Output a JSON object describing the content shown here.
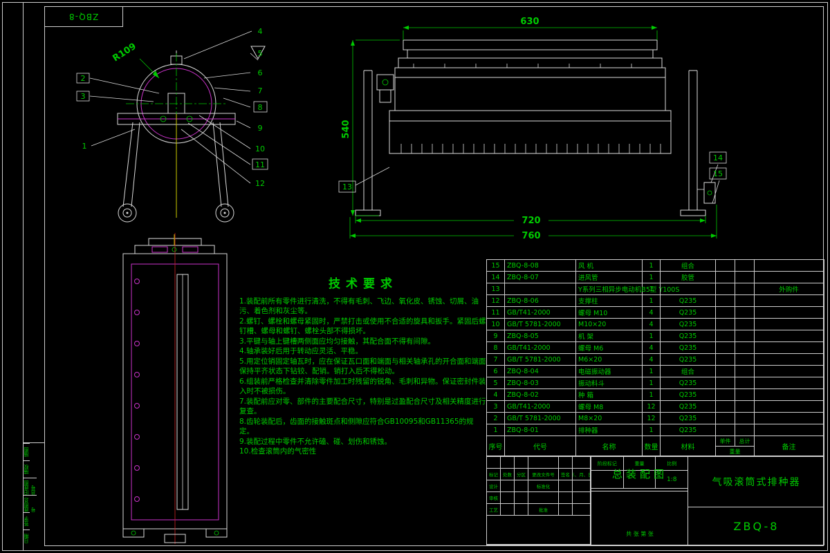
{
  "sheet": {
    "corner_label": "ZBQ-8",
    "margin_cells": [
      "描图",
      "描校",
      "旧底图总号",
      "底图总号",
      "签字",
      "日期"
    ]
  },
  "dimensions": {
    "width_top": "630",
    "height_left": "540",
    "width_feet": "720",
    "width_overall": "760",
    "radius": "R109"
  },
  "callouts": {
    "side_left": [
      "2",
      "3",
      "1"
    ],
    "side_right": [
      "4",
      "5",
      "6",
      "7",
      "8",
      "9",
      "10",
      "11",
      "12"
    ],
    "front": [
      "13",
      "14",
      "15"
    ]
  },
  "tech_requirements": {
    "title": "技术要求",
    "items": [
      "1.装配前所有零件进行清洗，不得有毛刺、飞边、氧化皮、锈蚀、切屑、油污、着色剂和灰尘等。",
      "2.螺钉、螺栓和螺母紧固时，严禁打击或使用不合适的旋具和扳手。紧固后螺钉槽、螺母和螺钉、螺栓头部不得损坏。",
      "3.平键与轴上键槽两侧面应均匀接触，其配合面不得有间隙。",
      "4.轴承装好后用于转动应灵活、平稳。",
      "5.用定位销固定轴瓦时，应在保证瓦口面和端面与相关轴承孔的开合面和端面保持平齐状态下钻铰、配销。销打入后不得松动。",
      "6.组装前严格检查并清除零件加工时残留的锐角、毛刺和异物。保证密封件装入时不被损伤。",
      "7.装配前应对零、部件的主要配合尺寸，特别是过盈配合尺寸及相关精度进行复查。",
      "8.齿轮装配后，齿面的接触斑点和侧隙应符合GB10095和GB11365的规定。",
      "9.装配过程中零件不允许磕、碰、划伤和锈蚀。",
      "10.检查滚筒内的气密性"
    ]
  },
  "bom": {
    "headers": {
      "seq": "序号",
      "code": "代号",
      "name": "名称",
      "qty": "数量",
      "material": "材料",
      "unit": "单件",
      "total": "总计",
      "weight": "重量",
      "remark": "备注"
    },
    "rows": [
      {
        "seq": "15",
        "code": "ZBQ-8-08",
        "name": "风 机",
        "qty": "1",
        "material": "组合",
        "unit": "",
        "total": "",
        "remark": ""
      },
      {
        "seq": "14",
        "code": "ZBQ-8-07",
        "name": "进风管",
        "qty": "1",
        "material": "胶管",
        "unit": "",
        "total": "",
        "remark": ""
      },
      {
        "seq": "13",
        "code": "",
        "name": "Y系列三相异步电动机B5型 Y100S",
        "qty": "1",
        "material": "",
        "unit": "",
        "total": "",
        "remark": "外购件"
      },
      {
        "seq": "12",
        "code": "ZBQ-8-06",
        "name": "支撑柱",
        "qty": "1",
        "material": "Q235",
        "unit": "",
        "total": "",
        "remark": ""
      },
      {
        "seq": "11",
        "code": "GB/T41-2000",
        "name": "螺母 M10",
        "qty": "4",
        "material": "Q235",
        "unit": "",
        "total": "",
        "remark": ""
      },
      {
        "seq": "10",
        "code": "GB/T 5781-2000",
        "name": "M10×20",
        "qty": "4",
        "material": "Q235",
        "unit": "",
        "total": "",
        "remark": ""
      },
      {
        "seq": "9",
        "code": "ZBQ-8-05",
        "name": "机 架",
        "qty": "1",
        "material": "Q235",
        "unit": "",
        "total": "",
        "remark": ""
      },
      {
        "seq": "8",
        "code": "GB/T41-2000",
        "name": "螺母 M6",
        "qty": "4",
        "material": "Q235",
        "unit": "",
        "total": "",
        "remark": ""
      },
      {
        "seq": "7",
        "code": "GB/T 5781-2000",
        "name": "M6×20",
        "qty": "4",
        "material": "Q235",
        "unit": "",
        "total": "",
        "remark": ""
      },
      {
        "seq": "6",
        "code": "ZBQ-8-04",
        "name": "电磁振动器",
        "qty": "1",
        "material": "组合",
        "unit": "",
        "total": "",
        "remark": ""
      },
      {
        "seq": "5",
        "code": "ZBQ-8-03",
        "name": "振动料斗",
        "qty": "1",
        "material": "Q235",
        "unit": "",
        "total": "",
        "remark": ""
      },
      {
        "seq": "4",
        "code": "ZBQ-8-02",
        "name": "种 箱",
        "qty": "1",
        "material": "Q235",
        "unit": "",
        "total": "",
        "remark": ""
      },
      {
        "seq": "3",
        "code": "GB/T41-2000",
        "name": "螺母 M8",
        "qty": "12",
        "material": "Q235",
        "unit": "",
        "total": "",
        "remark": ""
      },
      {
        "seq": "2",
        "code": "GB/T 5781-2000",
        "name": "M8×20",
        "qty": "12",
        "material": "Q235",
        "unit": "",
        "total": "",
        "remark": ""
      },
      {
        "seq": "1",
        "code": "ZBQ-8-01",
        "name": "排种器",
        "qty": "1",
        "material": "Q235",
        "unit": "",
        "total": "",
        "remark": ""
      }
    ]
  },
  "titleblock": {
    "drawing_type": "总装配图",
    "product": "气吸滚筒式排种器",
    "number": "ZBQ-8",
    "stage_label": "阶段标记",
    "weight_label": "重量",
    "scale_label": "比例",
    "scale": "1:8",
    "sheets_label": "共 张 第 张",
    "rev_headers": [
      "标记",
      "处数",
      "分区",
      "更改文件号",
      "签名",
      "年、月、日"
    ],
    "sign_rows": [
      [
        "设计",
        "",
        "",
        "标准化",
        "",
        ""
      ],
      [
        "审核",
        "",
        "",
        "",
        "",
        ""
      ],
      [
        "工艺",
        "",
        "",
        "批准",
        "",
        ""
      ]
    ]
  }
}
